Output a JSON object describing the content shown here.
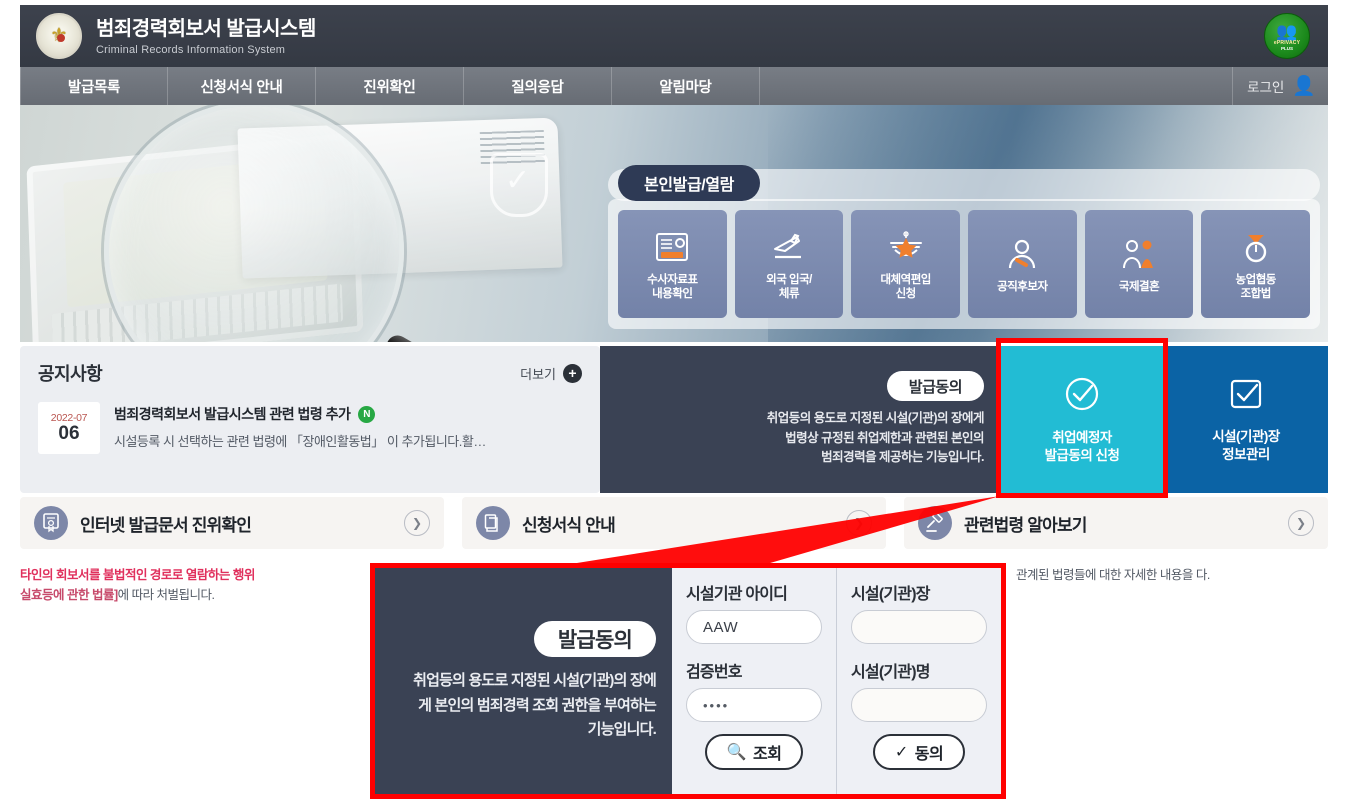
{
  "header": {
    "title": "범죄경력회보서 발급시스템",
    "subtitle": "Criminal Records Information System",
    "crest_icon": "police-crest-icon",
    "certification": {
      "name": "eprivacy-plus-badge",
      "glyph": "👥",
      "line1": "ePRIVACY",
      "line2": "PLUS"
    }
  },
  "nav": {
    "items": [
      {
        "label": "발급목록",
        "name": "nav-item-issue-list"
      },
      {
        "label": "신청서식 안내",
        "name": "nav-item-form-guide"
      },
      {
        "label": "진위확인",
        "name": "nav-item-verification"
      },
      {
        "label": "질의응답",
        "name": "nav-item-qna"
      },
      {
        "label": "알림마당",
        "name": "nav-item-notice-board"
      }
    ],
    "login_label": "로그인",
    "login_icon": "user-icon"
  },
  "hero": {
    "panel_tab_label": "본인발급/열람",
    "services": [
      {
        "label": "수사자료표\n내용확인",
        "line1": "수사자료표",
        "line2": "내용확인",
        "icon": "investigation-record-icon"
      },
      {
        "label": "외국 입국/\n체류",
        "line1": "외국 입국/",
        "line2": "체류",
        "icon": "airplane-icon"
      },
      {
        "label": "대체역편입\n신청",
        "line1": "대체역편입",
        "line2": "신청",
        "icon": "military-star-icon"
      },
      {
        "label": "공직후보자",
        "line1": "공직후보자",
        "line2": "",
        "icon": "person-icon"
      },
      {
        "label": "국제결혼",
        "line1": "국제결혼",
        "line2": "",
        "icon": "couple-icon"
      },
      {
        "label": "농업협동\n조합법",
        "line1": "농업협동",
        "line2": "조합법",
        "icon": "agriculture-coop-icon"
      }
    ]
  },
  "notice": {
    "title": "공지사항",
    "more_label": "더보기",
    "more_icon": "plus-icon",
    "item": {
      "date_ym": "2022-07",
      "date_day": "06",
      "subject": "범죄경력회보서 발급시스템 관련 법령 추가",
      "badge": "N",
      "body": "시설등록 시 선택하는 관련 법령에 「장애인활동법」 이 추가됩니다.활…"
    }
  },
  "consent_band": {
    "pill_label": "발급동의",
    "desc_line1": "취업등의 용도로 지정된 시설(기관)의 장에게",
    "desc_line2": "법령상 규정된 취업제한과 관련된 본인의",
    "desc_line3": "범죄경력을 제공하는 기능입니다.",
    "tiles": [
      {
        "name": "tile-applicant-consent",
        "icon": "check-circle-icon",
        "line1": "취업예정자",
        "line2": "발급동의 신청",
        "color": "#22bcd4",
        "highlighted": true
      },
      {
        "name": "tile-facility-info",
        "icon": "check-square-icon",
        "line1": "시설(기관)장",
        "line2": "정보관리",
        "color": "#0b63a5",
        "highlighted": false
      }
    ]
  },
  "cards": [
    {
      "name": "card-document-verification",
      "icon": "certificate-icon",
      "title": "인터넷 발급문서 진위확인",
      "arrow_icon": "chevron-right-icon",
      "body_warn": "타인의 회보서를 불법적인 경로로 열람하는 행위",
      "body_warn2": "실효등에 관한 법률]",
      "body_rest": "에 따라 처벌됩니다."
    },
    {
      "name": "card-form-guide",
      "icon": "document-icon",
      "title": "신청서식 안내",
      "arrow_icon": "chevron-right-icon",
      "body_warn": "",
      "body_warn2": "",
      "body_rest": ""
    },
    {
      "name": "card-related-laws",
      "icon": "gavel-icon",
      "title": "관련법령 알아보기",
      "arrow_icon": "chevron-right-icon",
      "body_warn": "",
      "body_warn2": "",
      "body_rest": "관계된 법령들에 대한 자세한 내용을\n다."
    }
  ],
  "popup": {
    "pill_label": "발급동의",
    "desc_line1": "취업등의 용도로 지정된 시설(기관)의 장에",
    "desc_line2": "게 본인의 범죄경력 조회 권한을 부여하는",
    "desc_line3": "기능입니다.",
    "fields": {
      "facility_id_label": "시설기관 아이디",
      "facility_id_value": "AAW",
      "facility_id_placeholder": "",
      "verify_code_label": "검증번호",
      "verify_code_value": "••••",
      "verify_code_placeholder": "",
      "facility_head_label": "시설(기관)장",
      "facility_head_value": "",
      "facility_head_placeholder": "",
      "facility_name_label": "시설(기관)명",
      "facility_name_value": "",
      "facility_name_placeholder": ""
    },
    "buttons": {
      "search_label": "조회",
      "search_icon": "search-icon",
      "agree_label": "동의",
      "agree_icon": "check-icon"
    }
  },
  "colors": {
    "header_bg": "#3a3f4a",
    "nav_bg": "#6e737b",
    "dark_panel": "#3a4254",
    "teal_tile": "#22bcd4",
    "blue_tile": "#0b63a5",
    "highlight_red": "#ff0000",
    "badge_green": "#27a844",
    "warn_red": "#e0305d"
  }
}
